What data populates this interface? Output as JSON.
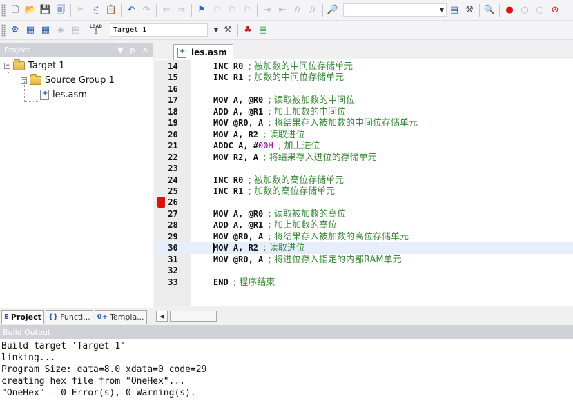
{
  "toolbar1": {
    "icons": [
      "new-file",
      "open-folder",
      "save",
      "save-all",
      "cut",
      "copy",
      "paste",
      "undo",
      "redo",
      "navigate-back",
      "navigate-forward",
      "bookmark-toggle",
      "bookmark-prev",
      "bookmark-next",
      "bookmark-clear",
      "indent",
      "unindent",
      "comment",
      "uncomment",
      "find-in-files",
      "search-box",
      "dropdown",
      "incremental-find",
      "config",
      "debug-session",
      "breakpoint-insert",
      "breakpoint-disable",
      "breakpoint-kill"
    ],
    "find_value": ""
  },
  "toolbar2": {
    "target_name": "Target 1",
    "load_label": "LOAD"
  },
  "project_pane": {
    "title": "Project",
    "controls": [
      "▼",
      "ᵽ",
      "✕"
    ],
    "tree": {
      "root": "Target 1",
      "group": "Source Group 1",
      "file": "les.asm"
    },
    "tabs": [
      {
        "label": "Project",
        "icon": "E"
      },
      {
        "label": "Functi...",
        "icon": "{}"
      },
      {
        "label": "Templa...",
        "icon": "0+"
      }
    ]
  },
  "editor": {
    "tab_label": "les.asm",
    "current_line": 30,
    "breakpoint_line": 26,
    "lines": [
      {
        "n": 14,
        "code": "INC R0 ",
        "comment": "; 被加数的中间位存储单元"
      },
      {
        "n": 15,
        "code": "INC R1 ",
        "comment": "; 加数的中间位存储单元"
      },
      {
        "n": 16,
        "code": "",
        "comment": ""
      },
      {
        "n": 17,
        "code": "MOV A, @R0 ",
        "comment": "; 读取被加数的中间位"
      },
      {
        "n": 18,
        "code": "ADD A, @R1 ",
        "comment": "; 加上加数的中间位"
      },
      {
        "n": 19,
        "code": "MOV @R0, A ",
        "comment": "; 将结果存入被加数的中间位存储单元"
      },
      {
        "n": 20,
        "code": "MOV A, R2 ",
        "comment": "; 读取进位"
      },
      {
        "n": 21,
        "code": "ADDC A, #",
        "num": "00H",
        "code2": " ",
        "comment": "; 加上进位"
      },
      {
        "n": 22,
        "code": "MOV R2, A ",
        "comment": "; 将结果存入进位的存储单元"
      },
      {
        "n": 23,
        "code": "",
        "comment": ""
      },
      {
        "n": 24,
        "code": "INC R0 ",
        "comment": "; 被加数的高位存储单元"
      },
      {
        "n": 25,
        "code": "INC R1 ",
        "comment": "; 加数的高位存储单元"
      },
      {
        "n": 26,
        "code": "",
        "comment": ""
      },
      {
        "n": 27,
        "code": "MOV A, @R0 ",
        "comment": "; 读取被加数的高位"
      },
      {
        "n": 28,
        "code": "ADD A, @R1 ",
        "comment": "; 加上加数的高位"
      },
      {
        "n": 29,
        "code": "MOV @R0, A ",
        "comment": "; 将结果存入被加数的高位存储单元"
      },
      {
        "n": 30,
        "code": "MOV A, R2 ",
        "comment": "; 读取进位"
      },
      {
        "n": 31,
        "code": "MOV @R0, A ",
        "comment": "; 将进位存入指定的内部RAM单元"
      },
      {
        "n": 32,
        "code": "",
        "comment": ""
      },
      {
        "n": 33,
        "code": "END ",
        "comment": "; 程序结束"
      }
    ]
  },
  "build_output": {
    "title": "Build Output",
    "lines": [
      "Build target 'Target 1'",
      "linking...",
      "Program Size: data=8.0 xdata=0 code=29",
      "creating hex file from \"OneHex\"...",
      "\"OneHex\" - 0 Error(s), 0 Warning(s)."
    ]
  },
  "colors": {
    "pane_title_bg": "#cfd3d8",
    "comment": "#3a8a3a",
    "number": "#a000a0",
    "breakpoint": "#e01010",
    "current_line_bg": "#e6eefc"
  }
}
